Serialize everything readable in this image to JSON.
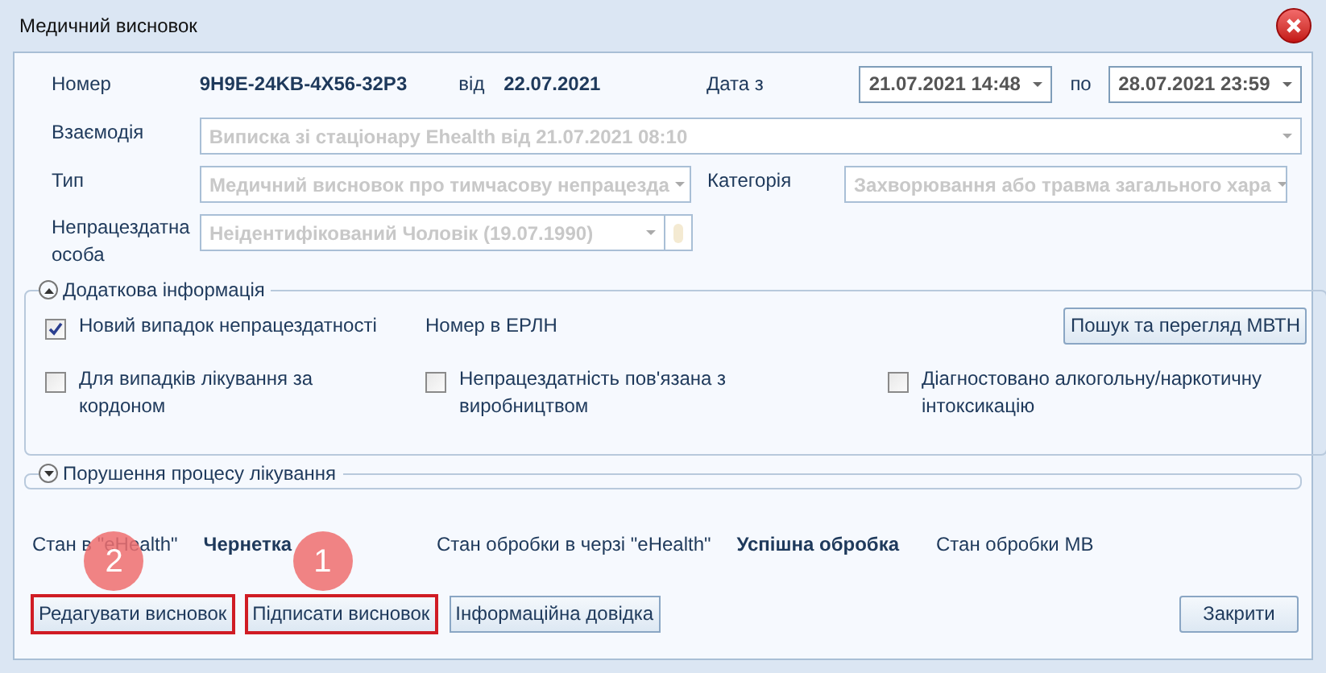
{
  "window": {
    "title": "Медичний висновок"
  },
  "header": {
    "number_label": "Номер",
    "number": "9H9E-24KB-4X56-32P3",
    "from_label": "від",
    "date": "22.07.2021",
    "date_from_label": "Дата з",
    "date_from": "21.07.2021 14:48",
    "date_to_label": "по",
    "date_to": "28.07.2021 23:59"
  },
  "interaction": {
    "label": "Взаємодія",
    "value": "Виписка зі стаціонару Ehealth від 21.07.2021 08:10",
    "disabled": true
  },
  "type": {
    "label": "Тип",
    "value": "Медичний висновок про тимчасову непрацезда",
    "disabled": true
  },
  "category": {
    "label": "Категорія",
    "value": "Захворювання або травма загального хара",
    "disabled": true
  },
  "person": {
    "label": "Непрацездатна особа",
    "value": "Неідентифікований Чоловік (19.07.1990)",
    "disabled": true
  },
  "sections": [
    {
      "title": "Додаткова інформація",
      "expanded": true
    },
    {
      "title": "Порушення процесу лікування",
      "expanded": false
    }
  ],
  "checkboxes": [
    {
      "label": "Новий випадок непрацездатності",
      "checked": true
    },
    {
      "label": "Для випадків лікування за кордоном",
      "checked": false
    },
    {
      "label": "Непрацездатність пов'язана з виробництвом",
      "checked": false
    },
    {
      "label": "Діагностовано алкогольну/наркотичну інтоксикацію",
      "checked": false
    }
  ],
  "erln_label": "Номер в ЕРЛН",
  "search_button": "Пошук та перегляд МВТН",
  "status": [
    {
      "label": "Стан в \"eHealth\"",
      "value": "Чернетка"
    },
    {
      "label": "Стан обробки в черзі \"eHealth\"",
      "value": "Успішна обробка"
    },
    {
      "label": "Стан обробки МВ"
    }
  ],
  "buttons": [
    {
      "label": "Редагувати висновок",
      "highlighted": true,
      "badge": "2"
    },
    {
      "label": "Підписати висновок",
      "highlighted": true,
      "badge": "1"
    },
    {
      "label": "Інформаційна довідка",
      "highlighted": false
    }
  ],
  "close_button": "Закрити"
}
